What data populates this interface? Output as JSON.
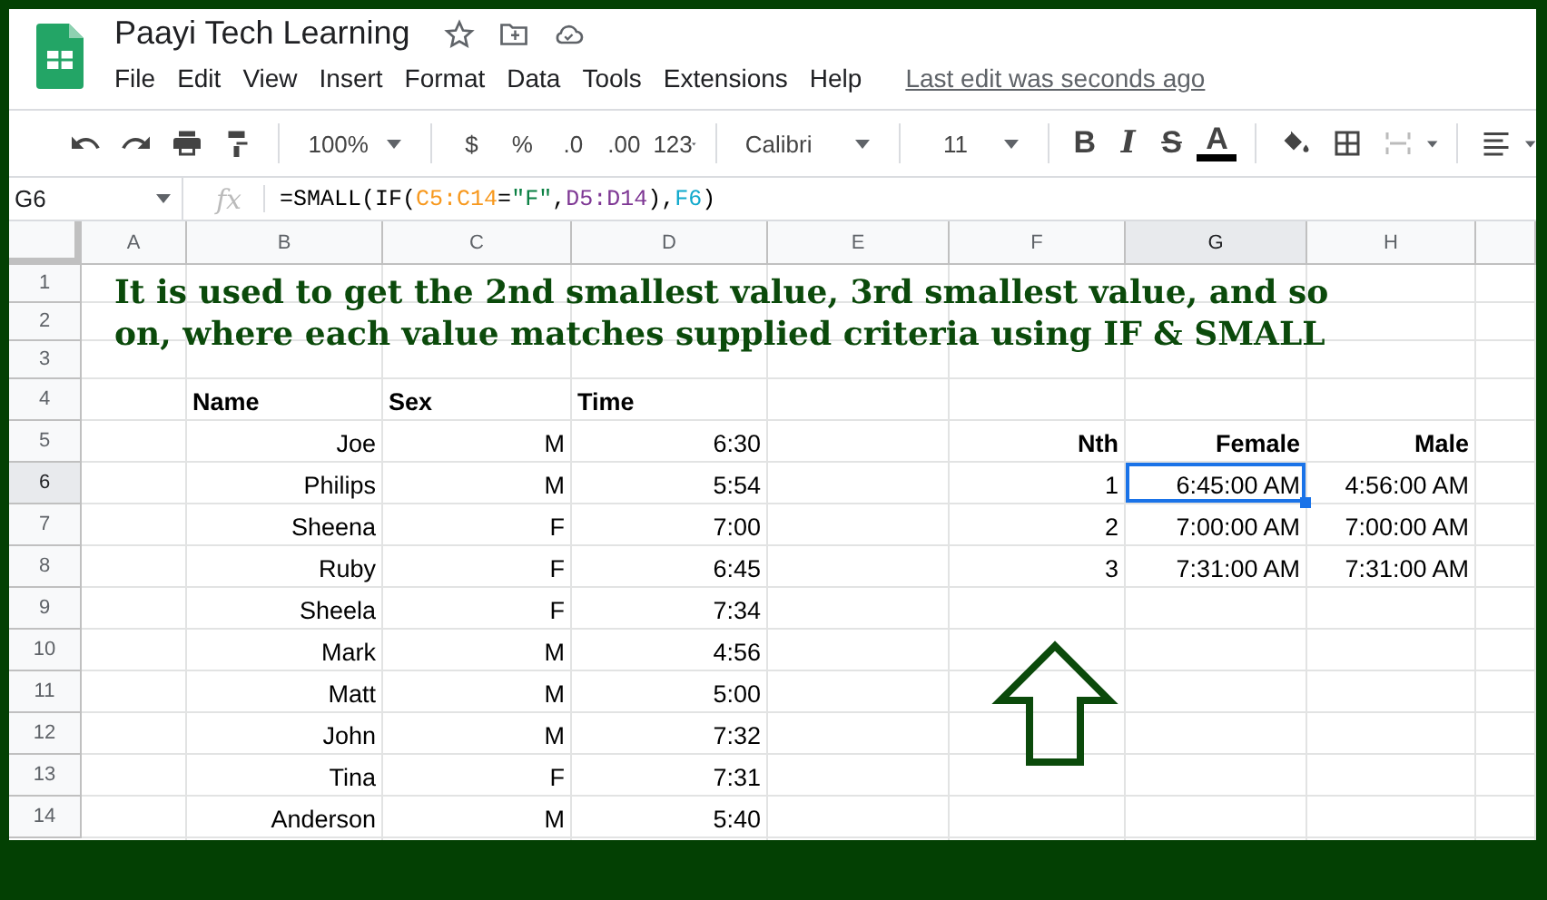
{
  "document": {
    "title": "Paayi Tech Learning",
    "last_edit": "Last edit was seconds ago"
  },
  "menu": [
    "File",
    "Edit",
    "View",
    "Insert",
    "Format",
    "Data",
    "Tools",
    "Extensions",
    "Help"
  ],
  "toolbar": {
    "zoom": "100%",
    "currency": "$",
    "percent": "%",
    "decrease_decimals": ".0",
    "increase_decimals": ".00",
    "more_formats": "123",
    "font": "Calibri",
    "font_size": "11",
    "text_styles": [
      {
        "kind": "bold",
        "label": "B"
      },
      {
        "kind": "italic",
        "label": "I"
      },
      {
        "kind": "strike",
        "label": "S"
      },
      {
        "kind": "color",
        "label": "A"
      }
    ]
  },
  "formula_bar": {
    "cell": "G6",
    "function_label": "fx",
    "tokens": [
      {
        "text": "=SMALL(IF(",
        "color": "#000000"
      },
      {
        "text": "C5:C14",
        "color": "#f7981d"
      },
      {
        "text": "=",
        "color": "#000000"
      },
      {
        "text": "\"F\"",
        "color": "#0b8043"
      },
      {
        "text": ",",
        "color": "#000000"
      },
      {
        "text": "D5:D14",
        "color": "#7e3794"
      },
      {
        "text": "),",
        "color": "#000000"
      },
      {
        "text": "F6",
        "color": "#11a9cc"
      },
      {
        "text": ")",
        "color": "#000000"
      }
    ]
  },
  "columns": [
    {
      "label": "A",
      "selected": false
    },
    {
      "label": "B",
      "selected": false
    },
    {
      "label": "C",
      "selected": false
    },
    {
      "label": "D",
      "selected": false
    },
    {
      "label": "E",
      "selected": false
    },
    {
      "label": "F",
      "selected": false
    },
    {
      "label": "G",
      "selected": true
    },
    {
      "label": "H",
      "selected": false
    }
  ],
  "row_headers": [
    {
      "label": "1",
      "selected": false
    },
    {
      "label": "2",
      "selected": false
    },
    {
      "label": "3",
      "selected": false
    },
    {
      "label": "4",
      "selected": false
    },
    {
      "label": "5",
      "selected": false
    },
    {
      "label": "6",
      "selected": true
    },
    {
      "label": "7",
      "selected": false
    },
    {
      "label": "8",
      "selected": false
    },
    {
      "label": "9",
      "selected": false
    },
    {
      "label": "10",
      "selected": false
    },
    {
      "label": "11",
      "selected": false
    },
    {
      "label": "12",
      "selected": false
    },
    {
      "label": "13",
      "selected": false
    },
    {
      "label": "14",
      "selected": false
    }
  ],
  "note": "It is used to get the 2nd smallest value, 3rd smallest value, and so on, where each value matches supplied criteria using IF & SMALL",
  "data_table": {
    "header": [
      "Name",
      "Sex",
      "Time"
    ],
    "rows": [
      [
        "Joe",
        "M",
        "6:30"
      ],
      [
        "Philips",
        "M",
        "5:54"
      ],
      [
        "Sheena",
        "F",
        "7:00"
      ],
      [
        "Ruby",
        "F",
        "6:45"
      ],
      [
        "Sheela",
        "F",
        "7:34"
      ],
      [
        "Mark",
        "M",
        "4:56"
      ],
      [
        "Matt",
        "M",
        "5:00"
      ],
      [
        "John",
        "M",
        "7:32"
      ],
      [
        "Tina",
        "F",
        "7:31"
      ],
      [
        "Anderson",
        "M",
        "5:40"
      ]
    ]
  },
  "results_table": {
    "header": [
      "Nth",
      "Female",
      "Male"
    ],
    "rows": [
      [
        {
          "text": "1",
          "selected": false
        },
        {
          "text": "6:45:00 AM",
          "selected": true
        },
        {
          "text": "4:56:00 AM",
          "selected": false
        }
      ],
      [
        {
          "text": "2",
          "selected": false
        },
        {
          "text": "7:00:00 AM",
          "selected": false
        },
        {
          "text": "7:00:00 AM",
          "selected": false
        }
      ],
      [
        {
          "text": "3",
          "selected": false
        },
        {
          "text": "7:31:00 AM",
          "selected": false
        },
        {
          "text": "7:31:00 AM",
          "selected": false
        }
      ]
    ]
  }
}
